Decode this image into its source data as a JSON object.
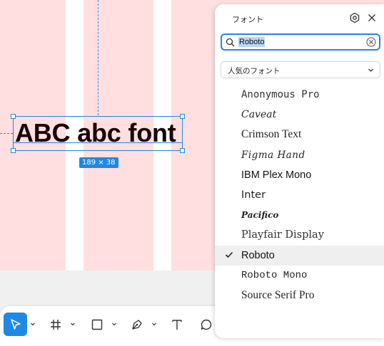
{
  "canvas": {
    "sample_text": "ABC abc font",
    "size_badge": "189 × 38",
    "colors": {
      "background": "#ffdfdf",
      "stripe": "#ffffff",
      "selection": "#1e88e5",
      "text": "#1c0000"
    }
  },
  "font_panel": {
    "title": "フォント",
    "icons": [
      "settings-hex-icon",
      "close-icon"
    ],
    "search": {
      "value": "Roboto",
      "clear_icon": "clear-circle-icon"
    },
    "filter": {
      "label": "人気のフォント"
    },
    "selected_font": "Roboto",
    "fonts": [
      "Anonymous Pro",
      "Caveat",
      "Crimson Text",
      "Figma Hand",
      "IBM Plex Mono",
      "Inter",
      "Pacifico",
      "Playfair Display",
      "Roboto",
      "Roboto Mono",
      "Source Serif Pro"
    ]
  },
  "toolbar": {
    "tools": [
      {
        "name": "move-tool",
        "icon": "cursor-icon",
        "active": true
      },
      {
        "name": "frame-tool",
        "icon": "hash-frame-icon",
        "active": false
      },
      {
        "name": "rectangle-tool",
        "icon": "square-icon",
        "active": false
      },
      {
        "name": "pen-tool",
        "icon": "pen-icon",
        "active": false
      },
      {
        "name": "text-tool",
        "icon": "text-t-icon",
        "active": false
      },
      {
        "name": "comment-tool",
        "icon": "speech-bubble-icon",
        "active": false
      }
    ],
    "accent": "#1e88e5"
  }
}
